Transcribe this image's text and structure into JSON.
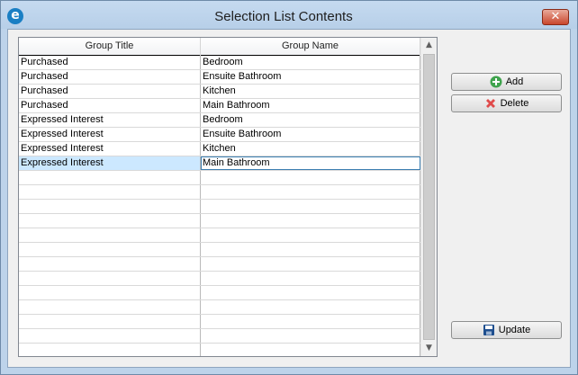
{
  "window": {
    "title": "Selection List Contents",
    "app_icon_letter": "e",
    "close_glyph": "✕"
  },
  "grid": {
    "columns": [
      "Group Title",
      "Group Name"
    ],
    "rows": [
      [
        "Purchased",
        "Bedroom"
      ],
      [
        "Purchased",
        "Ensuite Bathroom"
      ],
      [
        "Purchased",
        "Kitchen"
      ],
      [
        "Purchased",
        "Main Bathroom"
      ],
      [
        "Expressed Interest",
        "Bedroom"
      ],
      [
        "Expressed Interest",
        "Ensuite Bathroom"
      ],
      [
        "Expressed Interest",
        "Kitchen"
      ],
      [
        "Expressed Interest",
        "Main Bathroom"
      ]
    ],
    "selected_row": 7,
    "scroll_up_glyph": "▲",
    "scroll_down_glyph": "▼"
  },
  "buttons": {
    "add_label": "Add",
    "delete_label": "Delete",
    "update_label": "Update"
  },
  "colors": {
    "add_icon": "#3fa34d",
    "delete_icon": "#e04b4b",
    "update_icon": "#1f4f8f",
    "selection": "#cce8ff"
  }
}
